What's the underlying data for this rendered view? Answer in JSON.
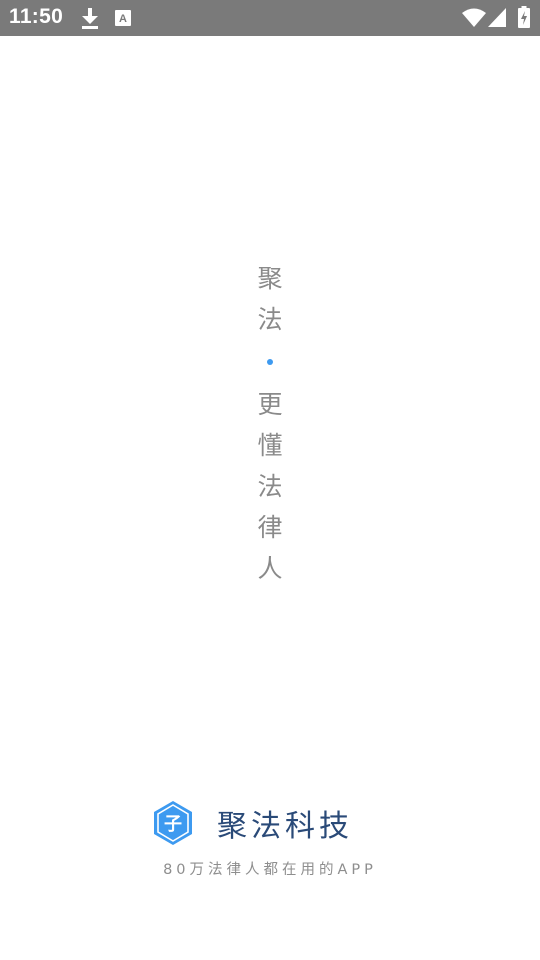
{
  "status_bar": {
    "time": "11:50",
    "icons": [
      "download-icon",
      "keyboard-a-icon",
      "wifi-icon",
      "signal-icon",
      "battery-charging-icon"
    ],
    "background": "#7a7a7a"
  },
  "splash": {
    "slogan_top": [
      "聚",
      "法"
    ],
    "slogan_bottom": [
      "更",
      "懂",
      "法",
      "律",
      "人"
    ],
    "dot_color": "#3d9af0",
    "text_color": "#8a8a8a"
  },
  "brand": {
    "logo_icon": "hexagon-shield-logo-icon",
    "logo_letter": "子",
    "name": "聚法科技",
    "tagline": "80万法律人都在用的APP",
    "name_color": "#2a4a78",
    "logo_color": "#3d9af0"
  }
}
